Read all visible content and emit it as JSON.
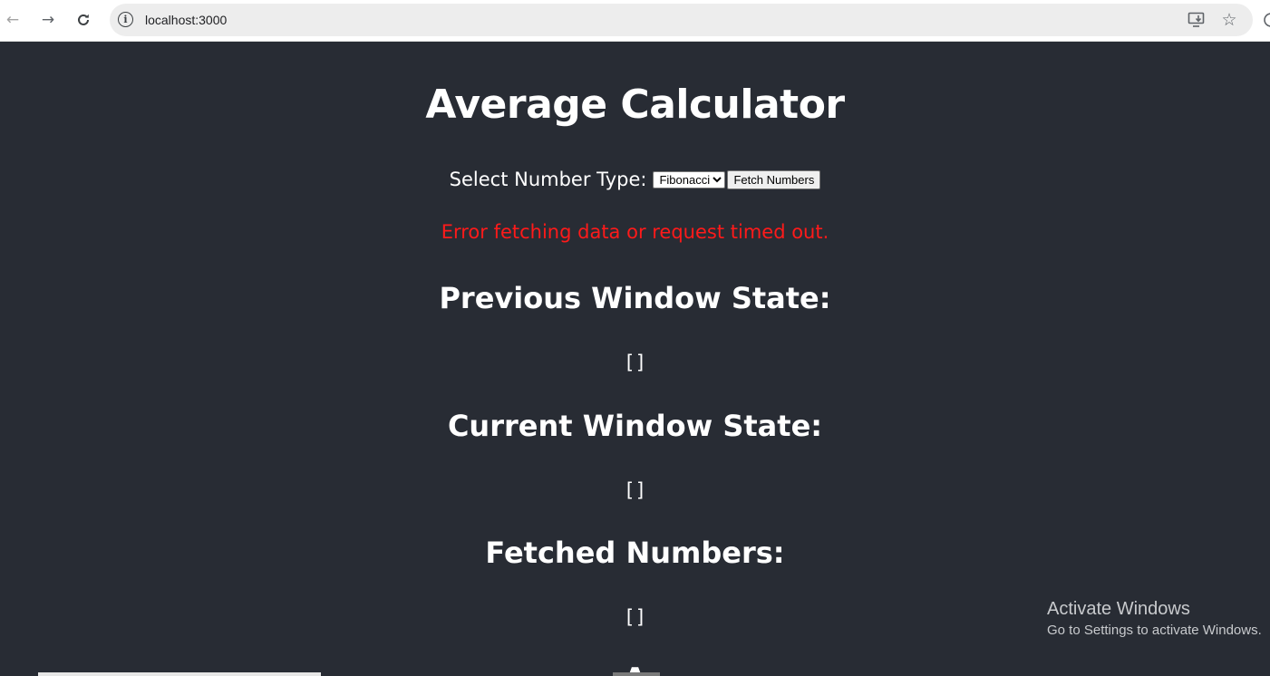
{
  "browser": {
    "url": "localhost:3000"
  },
  "page": {
    "title": "Average Calculator",
    "controls": {
      "label": "Select Number Type:",
      "selected_type": "Fibonacci",
      "fetch_button_label": "Fetch Numbers"
    },
    "error_message": "Error fetching data or request timed out.",
    "sections": {
      "previous": {
        "heading": "Previous Window State:",
        "value": "[]"
      },
      "current": {
        "heading": "Current Window State:",
        "value": "[]"
      },
      "fetched": {
        "heading": "Fetched Numbers:",
        "value": "[]"
      },
      "average_partial": {
        "heading": "A"
      }
    }
  },
  "os_overlay": {
    "activate_title": "Activate Windows",
    "activate_subtitle": "Go to Settings to activate Windows."
  },
  "colors": {
    "page_background": "#282c34",
    "error": "#ff1a1a"
  },
  "icons": {
    "back": "back-arrow-icon",
    "forward": "forward-arrow-icon",
    "reload": "reload-icon",
    "site_info": "info-icon",
    "install": "install-app-icon",
    "bookmark": "star-icon"
  }
}
